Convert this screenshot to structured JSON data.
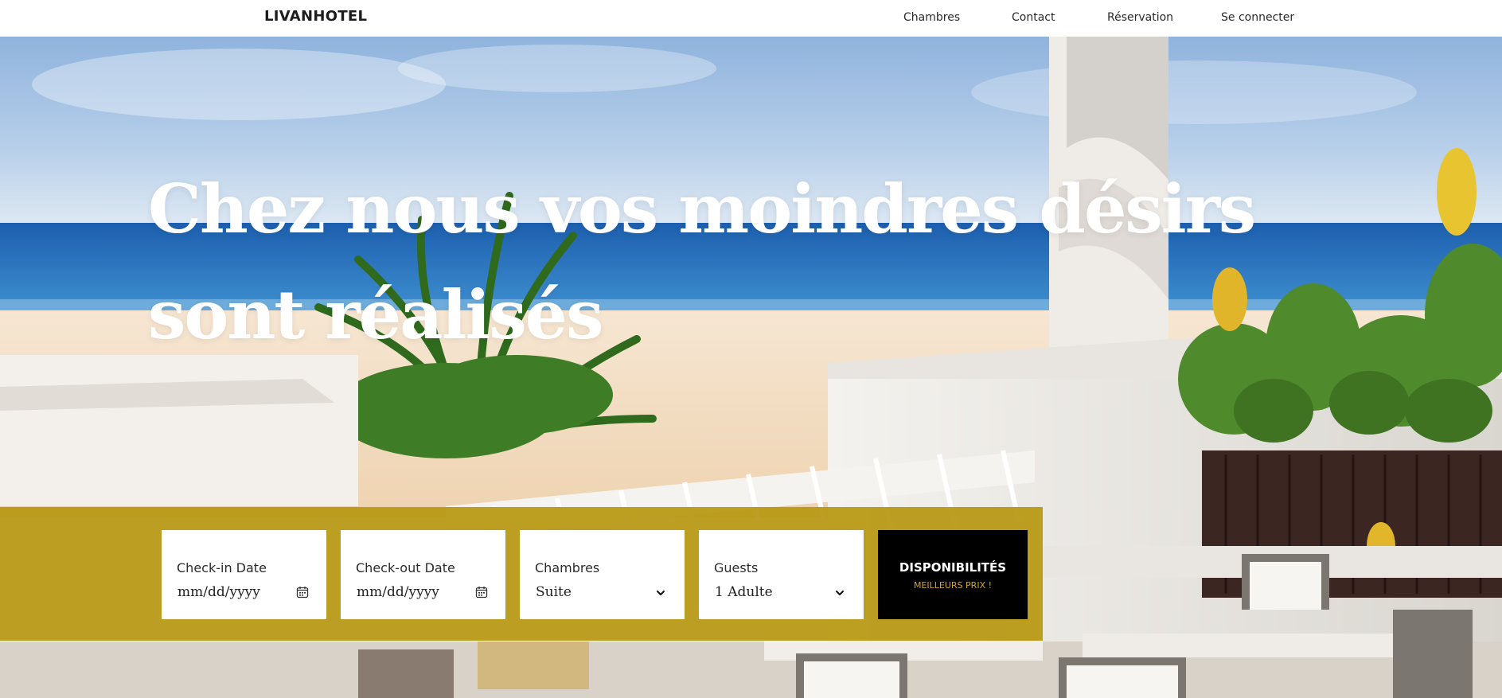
{
  "navbar": {
    "brand": "LIVANHOTEL",
    "links": [
      {
        "label": "Chambres"
      },
      {
        "label": "Contact"
      },
      {
        "label": "Réservation"
      },
      {
        "label": "Se connecter"
      }
    ]
  },
  "hero": {
    "headline_line1": "Chez nous vos moindres désirs",
    "headline_line2": "sont réalisés"
  },
  "booking": {
    "checkin": {
      "label": "Check-in Date",
      "placeholder": "mm/dd/yyyy"
    },
    "checkout": {
      "label": "Check-out Date",
      "placeholder": "mm/dd/yyyy"
    },
    "rooms": {
      "label": "Chambres",
      "value": "Suite"
    },
    "guests": {
      "label": "Guests",
      "value": "1 Adulte"
    },
    "submit": {
      "title": "DISPONIBILITÉS",
      "subtitle": "MEILLEURS PRIX !"
    }
  },
  "colors": {
    "booking_bar": "#b79811",
    "button_bg": "#000000",
    "button_sub": "#d4a62a",
    "sea": "#2b6fb4",
    "sand": "#f2dcc0"
  },
  "icons": [
    "calendar-icon",
    "chevron-down-icon"
  ]
}
